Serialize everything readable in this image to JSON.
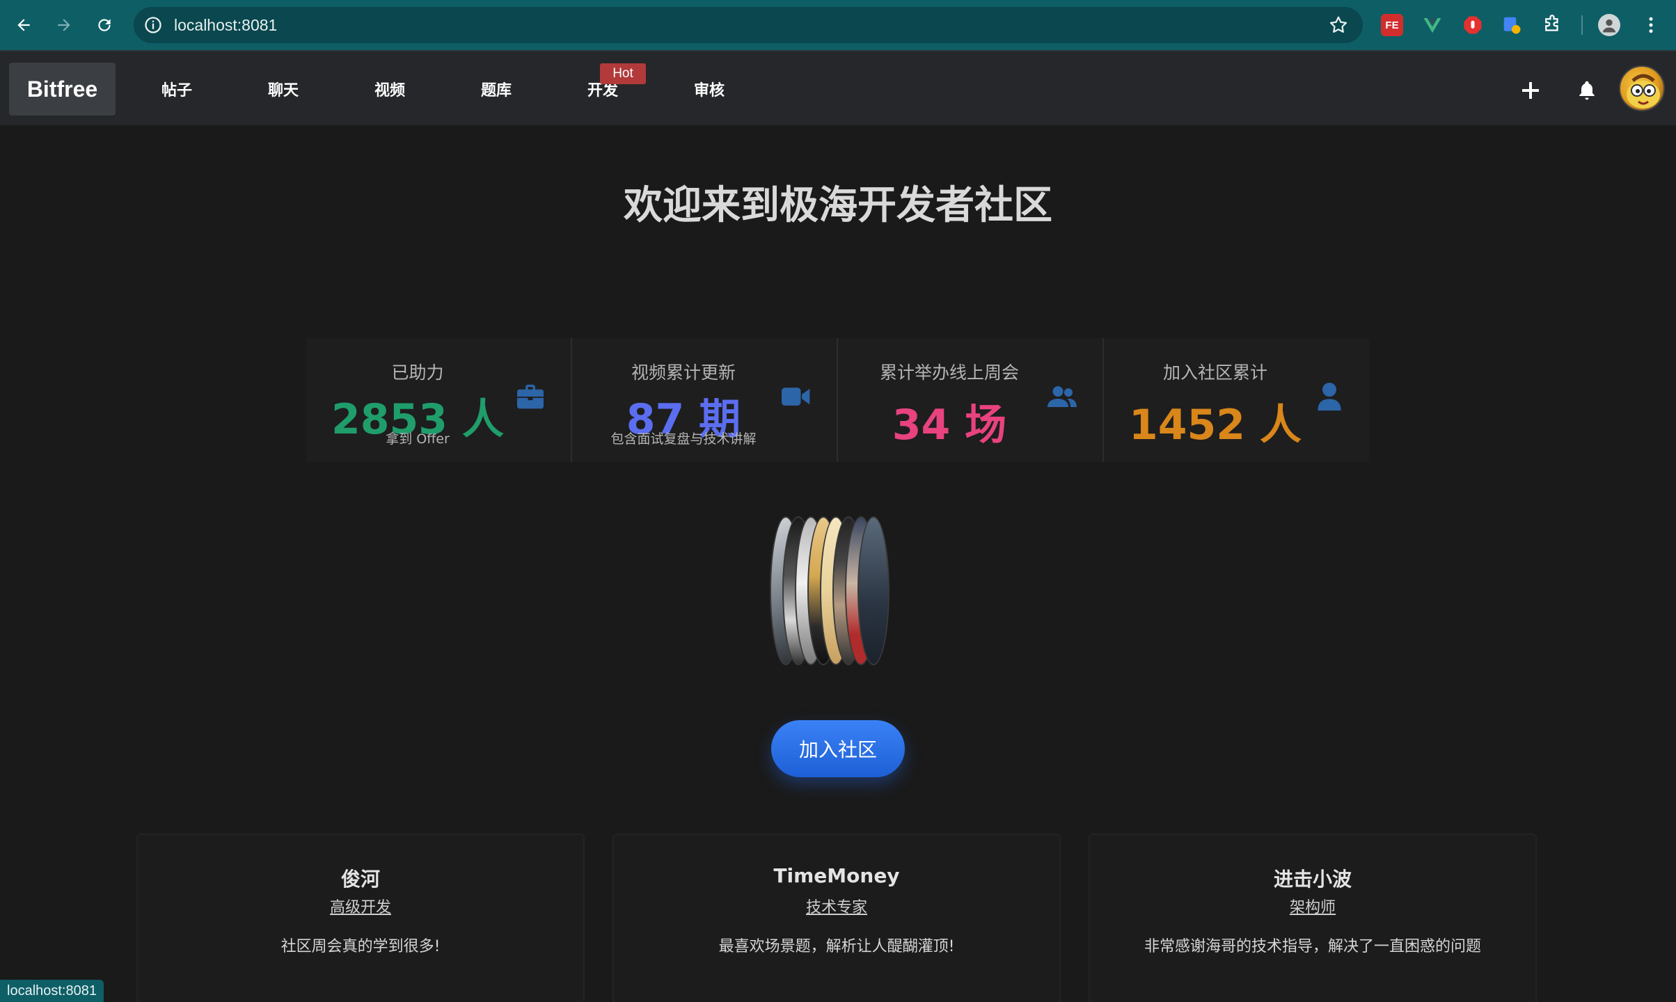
{
  "browser": {
    "url": "localhost:8081",
    "status_url": "localhost:8081",
    "extensions": [
      "FE",
      "vue-devtools",
      "adblock",
      "translate",
      "puzzle"
    ]
  },
  "navbar": {
    "logo": "Bitfree",
    "items": [
      {
        "label": "帖子"
      },
      {
        "label": "聊天"
      },
      {
        "label": "视频"
      },
      {
        "label": "题库"
      },
      {
        "label": "开发"
      },
      {
        "label": "审核"
      }
    ],
    "hot_badge": "Hot"
  },
  "main": {
    "title": "欢迎来到极海开发者社区",
    "join_button": "加入社区"
  },
  "stats": [
    {
      "label": "已助力",
      "value": "2853 人",
      "sub": "拿到 Offer",
      "color": "#1f9d6b",
      "icon": "briefcase-icon"
    },
    {
      "label": "视频累计更新",
      "value": "87 期",
      "sub": "包含面试复盘与技术讲解",
      "color": "#5b6ef0",
      "icon": "video-icon"
    },
    {
      "label": "累计举办线上周会",
      "value": "34 场",
      "sub": "",
      "color": "#e8427f",
      "icon": "users-icon"
    },
    {
      "label": "加入社区累计",
      "value": "1452 人",
      "sub": "",
      "color": "#d9861a",
      "icon": "user-icon"
    }
  ],
  "testimonials": [
    {
      "name": "俊河",
      "role": "高级开发",
      "quote": "社区周会真的学到很多!"
    },
    {
      "name": "TimeMoney",
      "role": "技术专家",
      "quote": "最喜欢场景题，解析让人醍醐灌顶!"
    },
    {
      "name": "进击小波",
      "role": "架构师",
      "quote": "非常感谢海哥的技术指导，解决了一直困惑的问题"
    }
  ],
  "colors": {
    "accent": "#2f6fe8",
    "hot": "#b23a3a",
    "chrome": "#0e5e66"
  }
}
